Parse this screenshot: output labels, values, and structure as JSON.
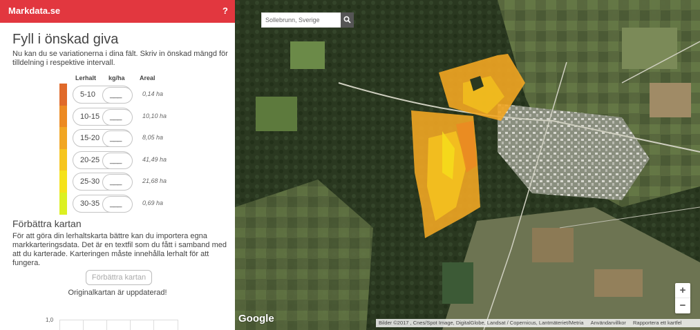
{
  "header": {
    "brand": "Markdata.se",
    "help_label": "?"
  },
  "title": "Fyll i önskad giva",
  "intro": "Nu kan du se variationerna i dina fält. Skriv in önskad mängd för tilldelning i respektive intervall.",
  "table": {
    "col_lerhalt": "Lerhalt",
    "col_kgha": "kg/ha",
    "col_areal": "Areal",
    "rows": [
      {
        "range": "5-10",
        "value": "___",
        "area": "0,14 ha",
        "color": "#e06a2a"
      },
      {
        "range": "10-15",
        "value": "___",
        "area": "10,10 ha",
        "color": "#ec8a22"
      },
      {
        "range": "15-20",
        "value": "___",
        "area": "8,05 ha",
        "color": "#f1a623"
      },
      {
        "range": "20-25",
        "value": "___",
        "area": "41,49 ha",
        "color": "#f6c51e"
      },
      {
        "range": "25-30",
        "value": "___",
        "area": "21,68 ha",
        "color": "#f5e21a"
      },
      {
        "range": "30-35",
        "value": "___",
        "area": "0,69 ha",
        "color": "#dcf023"
      }
    ]
  },
  "improve": {
    "heading": "Förbättra kartan",
    "text": "För att göra din lerhaltskarta bättre kan du importera egna markkarteringsdata. Det är en textfil som du fått i samband med att du karterade. Karteringen måste innehålla lerhalt för att fungera.",
    "button": "Förbättra kartan",
    "status": "Originalkartan är uppdaterad!"
  },
  "mini_chart": {
    "y_max_label": "1,0"
  },
  "map": {
    "search_value": "Sollebrunn, Sverige",
    "search_icon": "search-icon",
    "zoom_in": "+",
    "zoom_out": "−",
    "logo": "Google",
    "attribution": "Bilder ©2017 , Cnes/Spot Image, DigitalGlobe, Landsat / Copernicus, Lantmäteriet/Metria",
    "terms": "Användarvillkor",
    "report": "Rapportera ett kartfel",
    "watermark": "© 2017 Google"
  }
}
